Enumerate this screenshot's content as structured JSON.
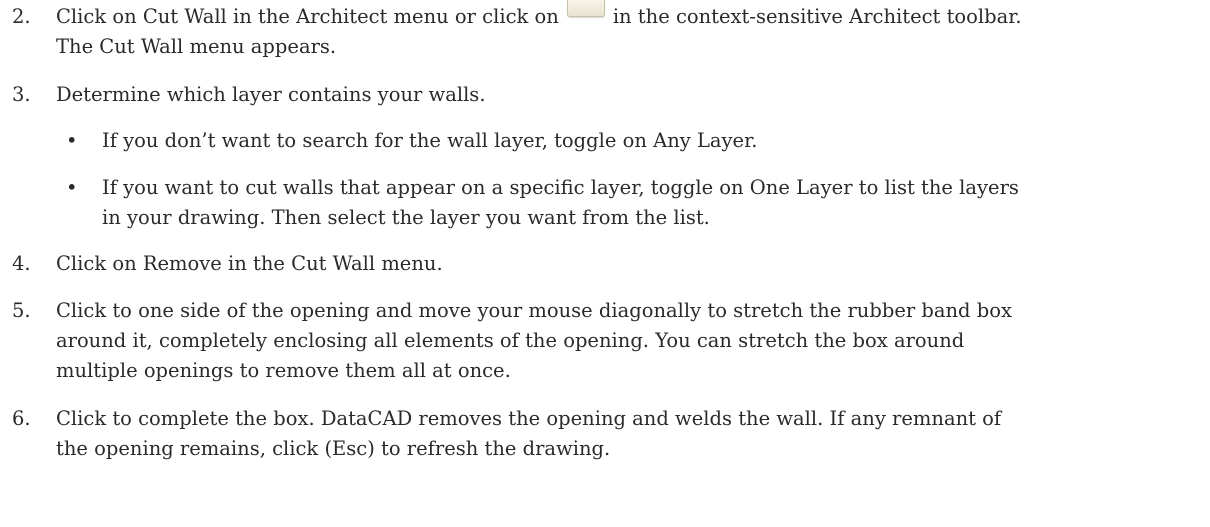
{
  "steps": [
    {
      "number": "2.",
      "text_before_icon": "Click on Cut Wall in the Architect menu or click on",
      "icon": "cut-wall-toolbar-icon",
      "text_after_icon": "in the context-sensitive Architect toolbar.",
      "line2": "The Cut Wall menu appears."
    },
    {
      "number": "3.",
      "text": "Determine which layer contains your walls.",
      "bullets": [
        {
          "symbol": "•",
          "text": "If you don’t want to search for the wall layer, toggle on Any Layer."
        },
        {
          "symbol": "•",
          "line1": "If you want to cut walls that appear on a specific layer, toggle on One Layer to list the layers",
          "line2": "in your drawing. Then select the layer you want from the list."
        }
      ]
    },
    {
      "number": "4.",
      "text": "Click on Remove in the Cut Wall menu."
    },
    {
      "number": "5.",
      "line1": "Click to one side of the opening and move your mouse diagonally to stretch the rubber band box",
      "line2": "around it, completely enclosing all elements of the opening. You can stretch the box around",
      "line3": "multiple openings to remove them all at once."
    },
    {
      "number": "6.",
      "line1": "Click to complete the box. DataCAD removes the opening and welds the wall. If any remnant of",
      "line2": "the opening remains, click (Esc) to refresh the drawing."
    }
  ]
}
